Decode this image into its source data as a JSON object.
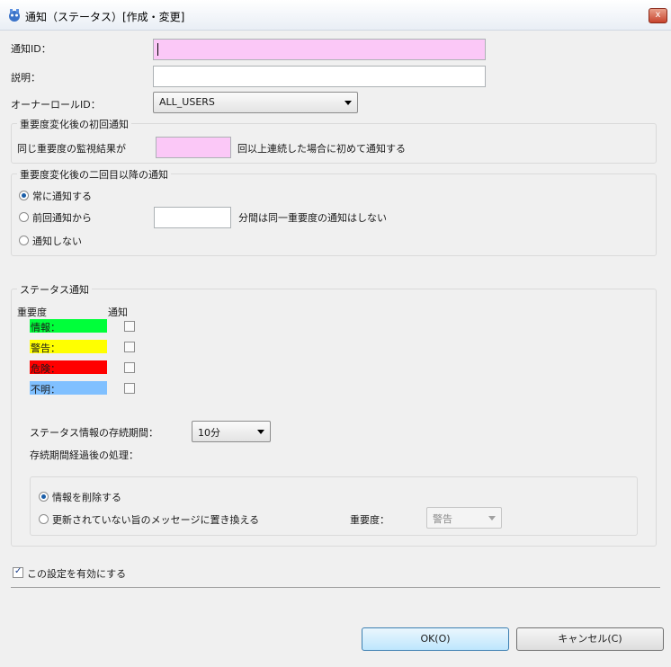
{
  "window": {
    "title": "通知（ステータス）[作成・変更]",
    "close_label": "x"
  },
  "form": {
    "notify_id": {
      "label": "通知ID：",
      "value": ""
    },
    "description": {
      "label": "説明：",
      "value": ""
    },
    "owner_role": {
      "label": "オーナーロールID：",
      "value": "ALL_USERS"
    }
  },
  "first_notify": {
    "title": "重要度変化後の初回通知",
    "prefix": "同じ重要度の監視結果が",
    "value": "",
    "suffix": "回以上連続した場合に初めて通知する"
  },
  "repeat_notify": {
    "title": "重要度変化後の二回目以降の通知",
    "option_always": "常に通知する",
    "option_interval_prefix": "前回通知から",
    "interval_value": "",
    "option_interval_suffix": "分間は同一重要度の通知はしない",
    "option_none": "通知しない",
    "selected": "always"
  },
  "status_notify": {
    "title": "ステータス通知",
    "col_severity": "重要度",
    "col_notify": "通知",
    "severities": [
      {
        "label": "情報：",
        "color": "#00ff3a",
        "checked": false
      },
      {
        "label": "警告：",
        "color": "#ffff00",
        "checked": false
      },
      {
        "label": "危険：",
        "color": "#ff0000",
        "checked": false
      },
      {
        "label": "不明：",
        "color": "#80c0ff",
        "checked": false
      }
    ],
    "retention_label": "ステータス情報の存続期間：",
    "retention_value": "10分",
    "after_label": "存続期間経過後の処理：",
    "option_delete": "情報を削除する",
    "option_replace": "更新されていない旨のメッセージに置き換える",
    "replace_severity_label": "重要度：",
    "replace_severity_value": "警告",
    "selected_after": "delete"
  },
  "enable": {
    "label": "この設定を有効にする",
    "checked": true
  },
  "buttons": {
    "ok": "OK(O)",
    "cancel": "キャンセル(C)"
  },
  "colors": {
    "pink_input": "#fbc8f7",
    "accent": "#1b5ea8"
  }
}
